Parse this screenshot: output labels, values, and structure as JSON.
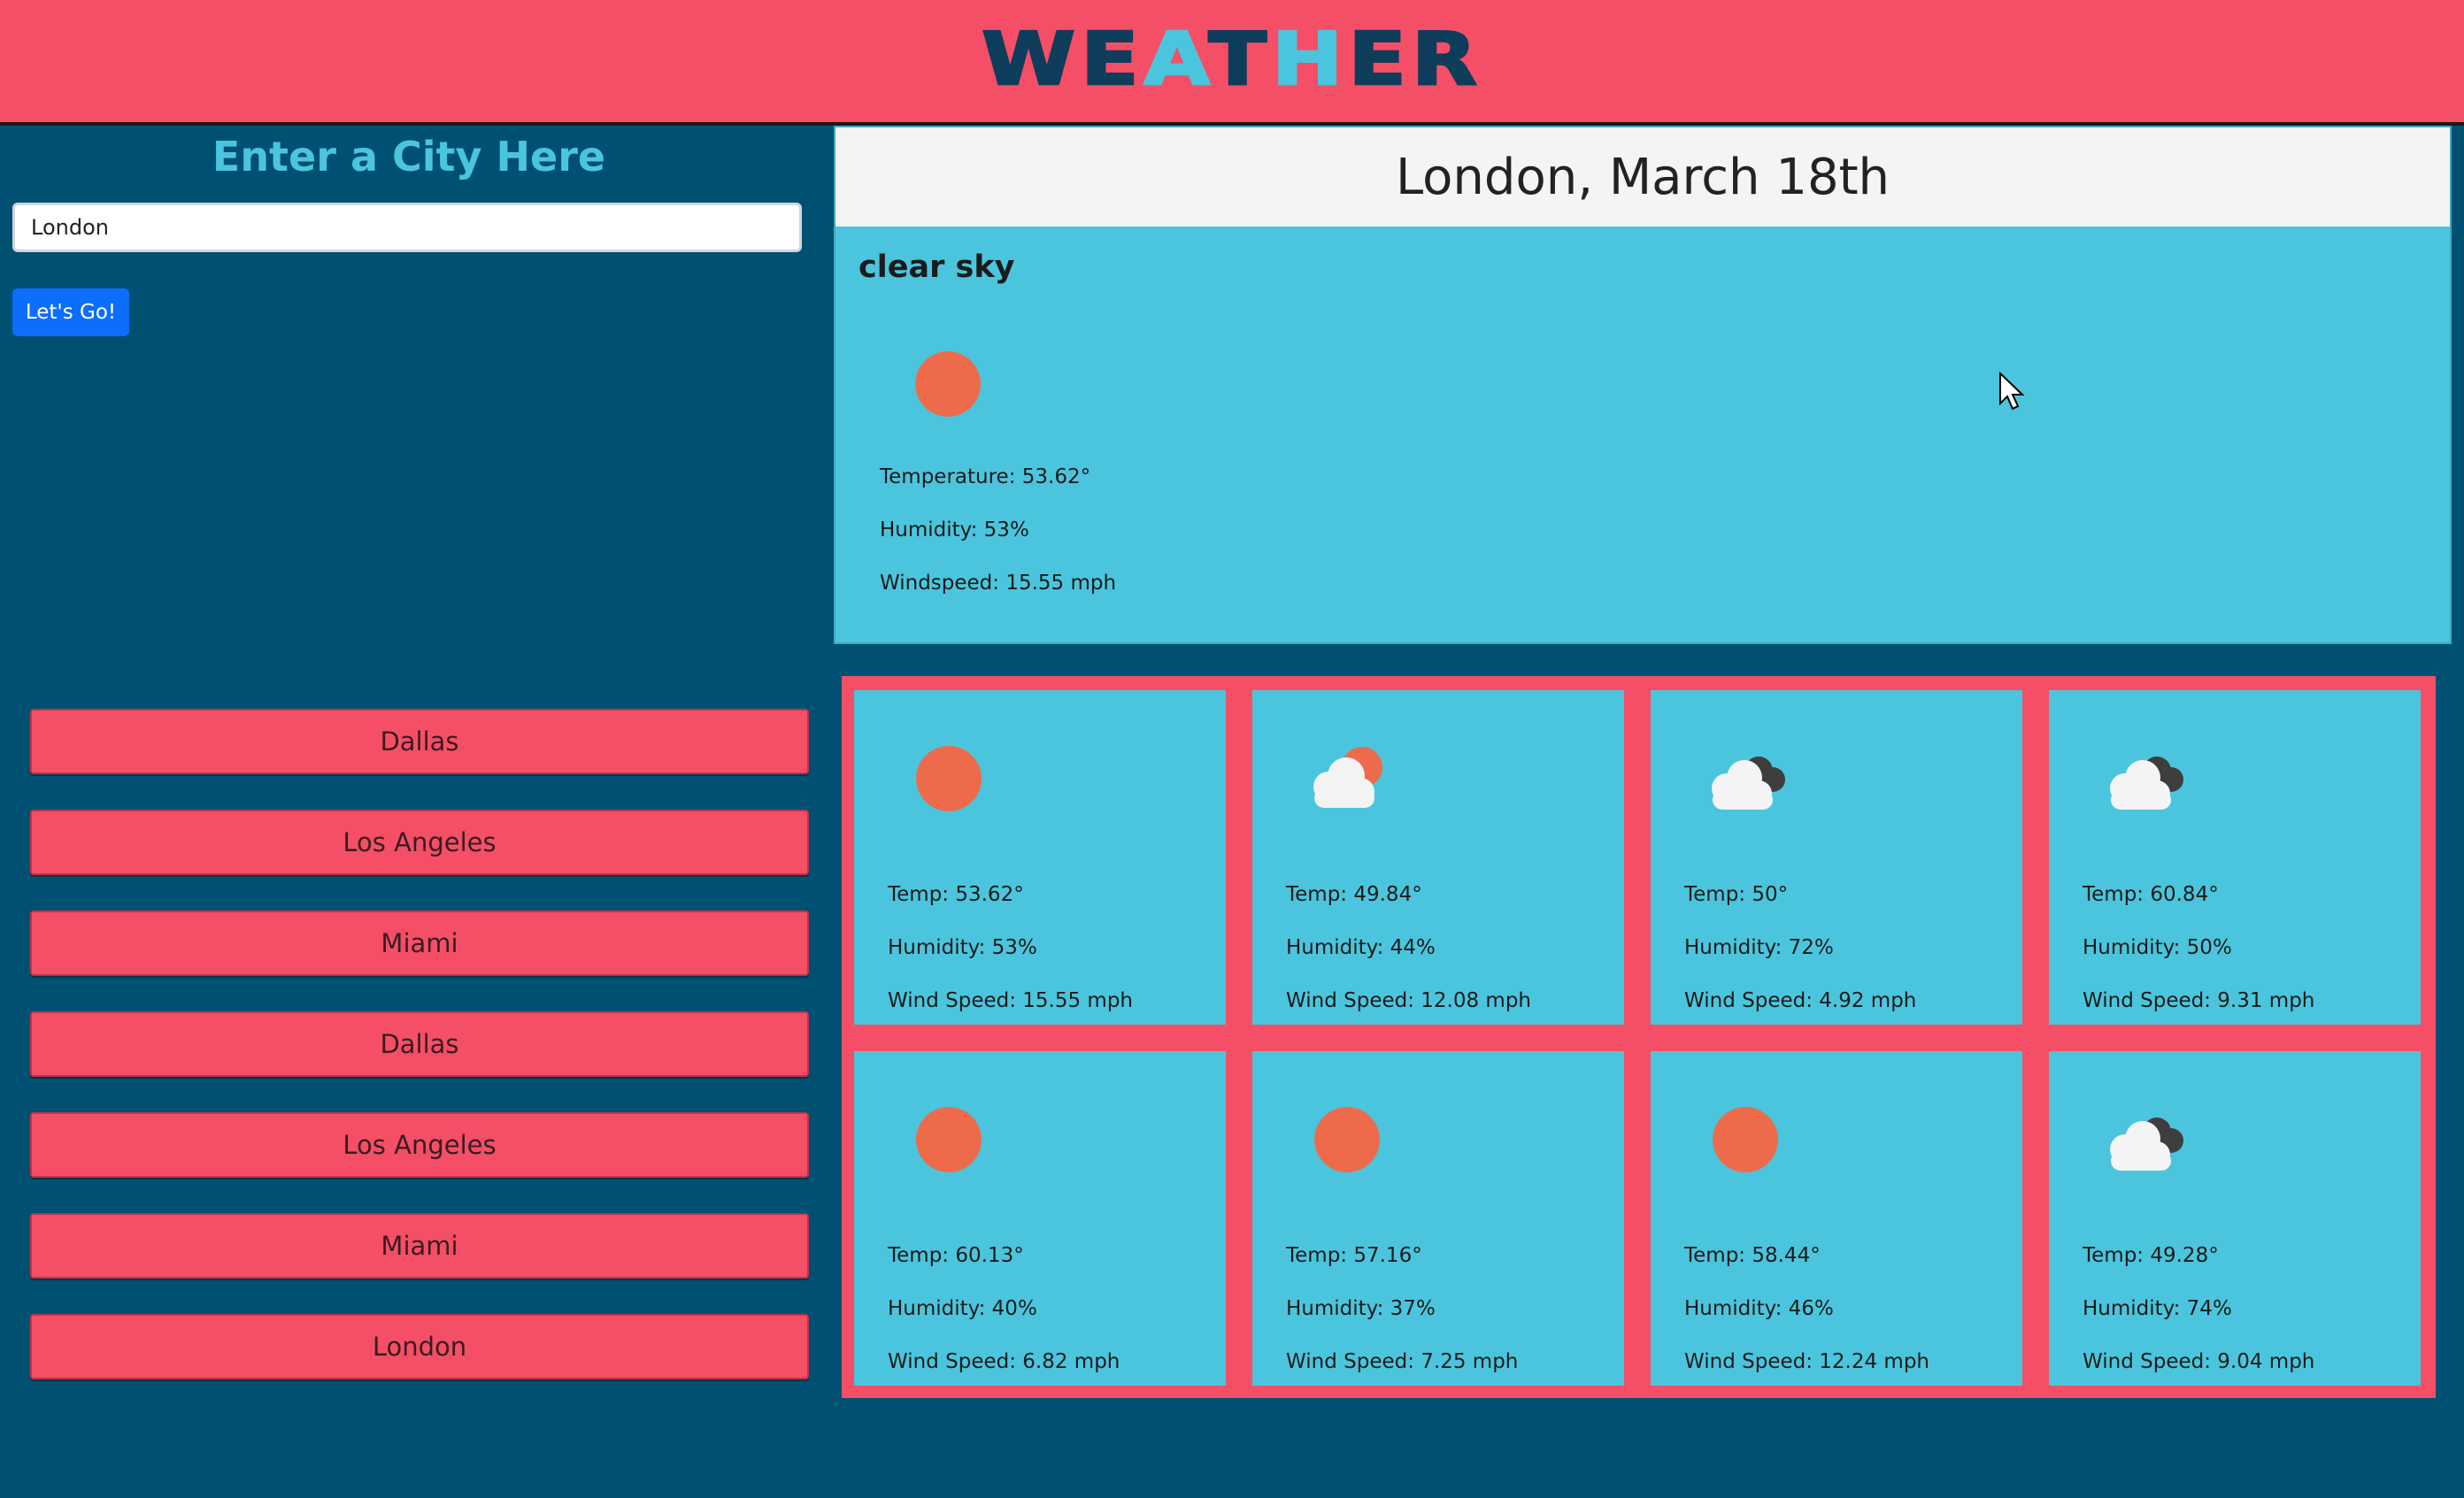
{
  "header": {
    "title_letters": [
      "W",
      "E",
      "A",
      "T",
      "H",
      "E",
      "R"
    ]
  },
  "sidebar": {
    "title": "Enter a City Here",
    "search": {
      "value": "London",
      "placeholder": ""
    },
    "go_label": "Let's Go!",
    "history": [
      "Dallas",
      "Los Angeles",
      "Miami",
      "Dallas",
      "Los Angeles",
      "Miami",
      "London"
    ]
  },
  "current": {
    "heading": "London, March 18th",
    "description": "clear sky",
    "icon": "sun-icon",
    "temperature": "Temperature: 53.62°",
    "humidity": "Humidity: 53%",
    "windspeed": "Windspeed: 15.55 mph"
  },
  "forecast": [
    {
      "icon": "sun-icon",
      "temp": "Temp: 53.62°",
      "humidity": "Humidity: 53%",
      "wind": "Wind Speed: 15.55 mph"
    },
    {
      "icon": "partly-cloudy-icon",
      "temp": "Temp: 49.84°",
      "humidity": "Humidity: 44%",
      "wind": "Wind Speed: 12.08 mph"
    },
    {
      "icon": "broken-clouds-icon",
      "temp": "Temp: 50°",
      "humidity": "Humidity: 72%",
      "wind": "Wind Speed: 4.92 mph"
    },
    {
      "icon": "broken-clouds-icon",
      "temp": "Temp: 60.84°",
      "humidity": "Humidity: 50%",
      "wind": "Wind Speed: 9.31 mph"
    },
    {
      "icon": "sun-icon",
      "temp": "Temp: 60.13°",
      "humidity": "Humidity: 40%",
      "wind": "Wind Speed: 6.82 mph"
    },
    {
      "icon": "sun-icon",
      "temp": "Temp: 57.16°",
      "humidity": "Humidity: 37%",
      "wind": "Wind Speed: 7.25 mph"
    },
    {
      "icon": "sun-icon",
      "temp": "Temp: 58.44°",
      "humidity": "Humidity: 46%",
      "wind": "Wind Speed: 12.24 mph"
    },
    {
      "icon": "broken-clouds-icon",
      "temp": "Temp: 49.28°",
      "humidity": "Humidity: 74%",
      "wind": "Wind Speed: 9.04 mph"
    }
  ],
  "colors": {
    "background": "#005072",
    "accent": "#f44f66",
    "panel": "#4bc5dd",
    "sun": "#ed6b4b",
    "button": "#0d6efd"
  }
}
